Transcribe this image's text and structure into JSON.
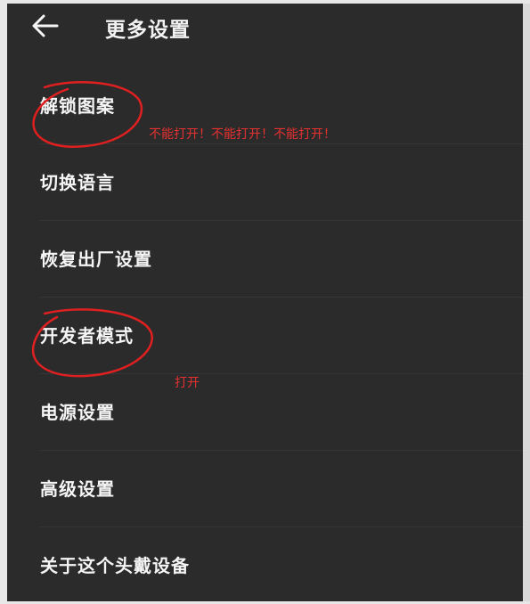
{
  "header": {
    "back_icon": "arrow-left-icon",
    "title": "更多设置"
  },
  "menu": {
    "items": [
      {
        "label": "解锁图案"
      },
      {
        "label": "切换语言"
      },
      {
        "label": "恢复出厂设置"
      },
      {
        "label": "开发者模式"
      },
      {
        "label": "电源设置"
      },
      {
        "label": "高级设置"
      },
      {
        "label": "关于这个头戴设备"
      }
    ]
  },
  "annotations": {
    "unlock_pattern_note": "不能打开！不能打开！不能打开！",
    "developer_mode_note": "打开",
    "color": "#e53030"
  },
  "colors": {
    "background": "#2b2b2b",
    "text": "#f5f5f5",
    "annotation": "#e53030"
  }
}
